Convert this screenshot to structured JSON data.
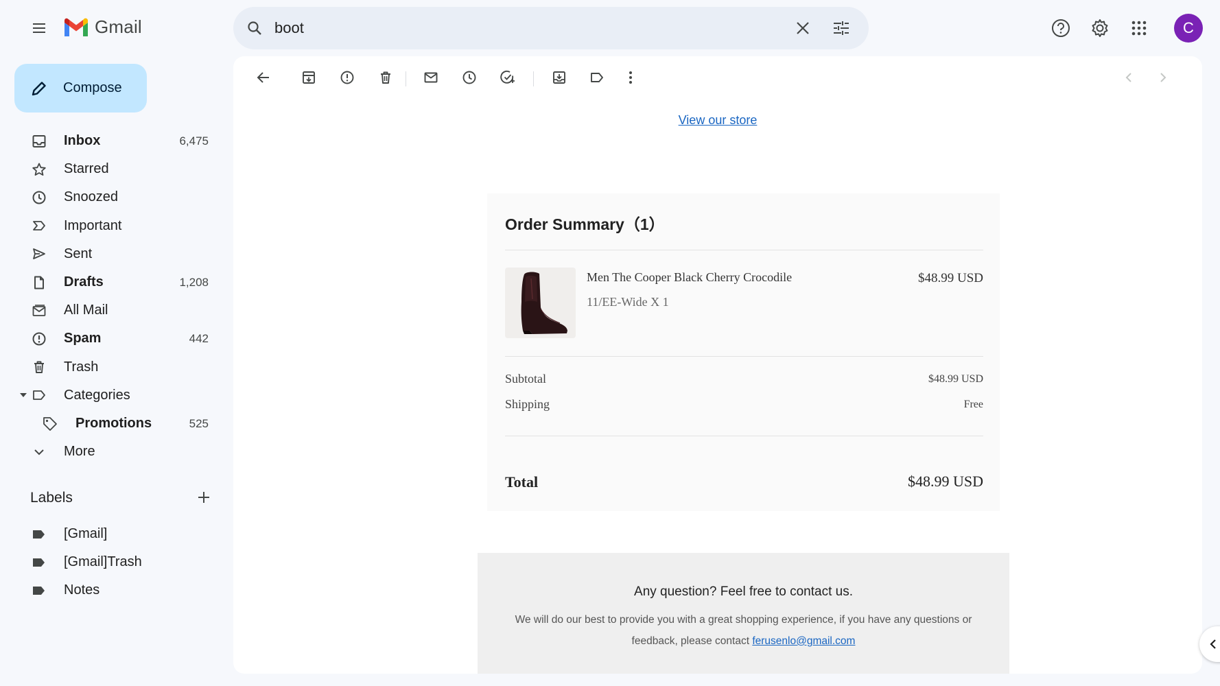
{
  "app": {
    "name": "Gmail"
  },
  "search": {
    "query": "boot"
  },
  "compose": {
    "label": "Compose"
  },
  "nav": [
    {
      "label": "Inbox",
      "count": "6,475",
      "icon": "inbox-icon",
      "bold": true
    },
    {
      "label": "Starred",
      "count": "",
      "icon": "star-icon",
      "bold": false
    },
    {
      "label": "Snoozed",
      "count": "",
      "icon": "clock-icon",
      "bold": false
    },
    {
      "label": "Important",
      "count": "",
      "icon": "important-icon",
      "bold": false
    },
    {
      "label": "Sent",
      "count": "",
      "icon": "send-icon",
      "bold": false
    },
    {
      "label": "Drafts",
      "count": "1,208",
      "icon": "draft-icon",
      "bold": true
    },
    {
      "label": "All Mail",
      "count": "",
      "icon": "all-mail-icon",
      "bold": false
    },
    {
      "label": "Spam",
      "count": "442",
      "icon": "spam-icon",
      "bold": true
    },
    {
      "label": "Trash",
      "count": "",
      "icon": "trash-icon",
      "bold": false
    },
    {
      "label": "Categories",
      "count": "",
      "icon": "label-icon",
      "bold": false
    },
    {
      "label": "Promotions",
      "count": "525",
      "icon": "tag-icon",
      "bold": true
    },
    {
      "label": "More",
      "count": "",
      "icon": "chevron-down-icon",
      "bold": false
    }
  ],
  "labels": {
    "heading": "Labels",
    "items": [
      "[Gmail]",
      "[Gmail]Trash",
      "Notes"
    ]
  },
  "user": {
    "initial": "C",
    "avatar_color": "#7a22b5"
  },
  "email": {
    "store_link": "View our store",
    "order": {
      "title": "Order Summary（1）",
      "product_name": "Men The Cooper Black Cherry Crocodile",
      "variant": "11/EE-Wide X 1",
      "price": "$48.99 USD",
      "subtotal_label": "Subtotal",
      "subtotal": "$48.99 USD",
      "shipping_label": "Shipping",
      "shipping": "Free",
      "total_label": "Total",
      "total": "$48.99 USD"
    },
    "contact": {
      "heading": "Any question? Feel free to contact us.",
      "body": "We will do our best to provide you with a great shopping experience, if you have any questions or feedback, please contact",
      "email": "ferusenlo@gmail.com"
    }
  },
  "colors": {
    "compose_bg": "#c2e7ff",
    "search_bg": "#e9eef6",
    "page_bg": "#f6f8fc",
    "link": "#1a66c2"
  }
}
